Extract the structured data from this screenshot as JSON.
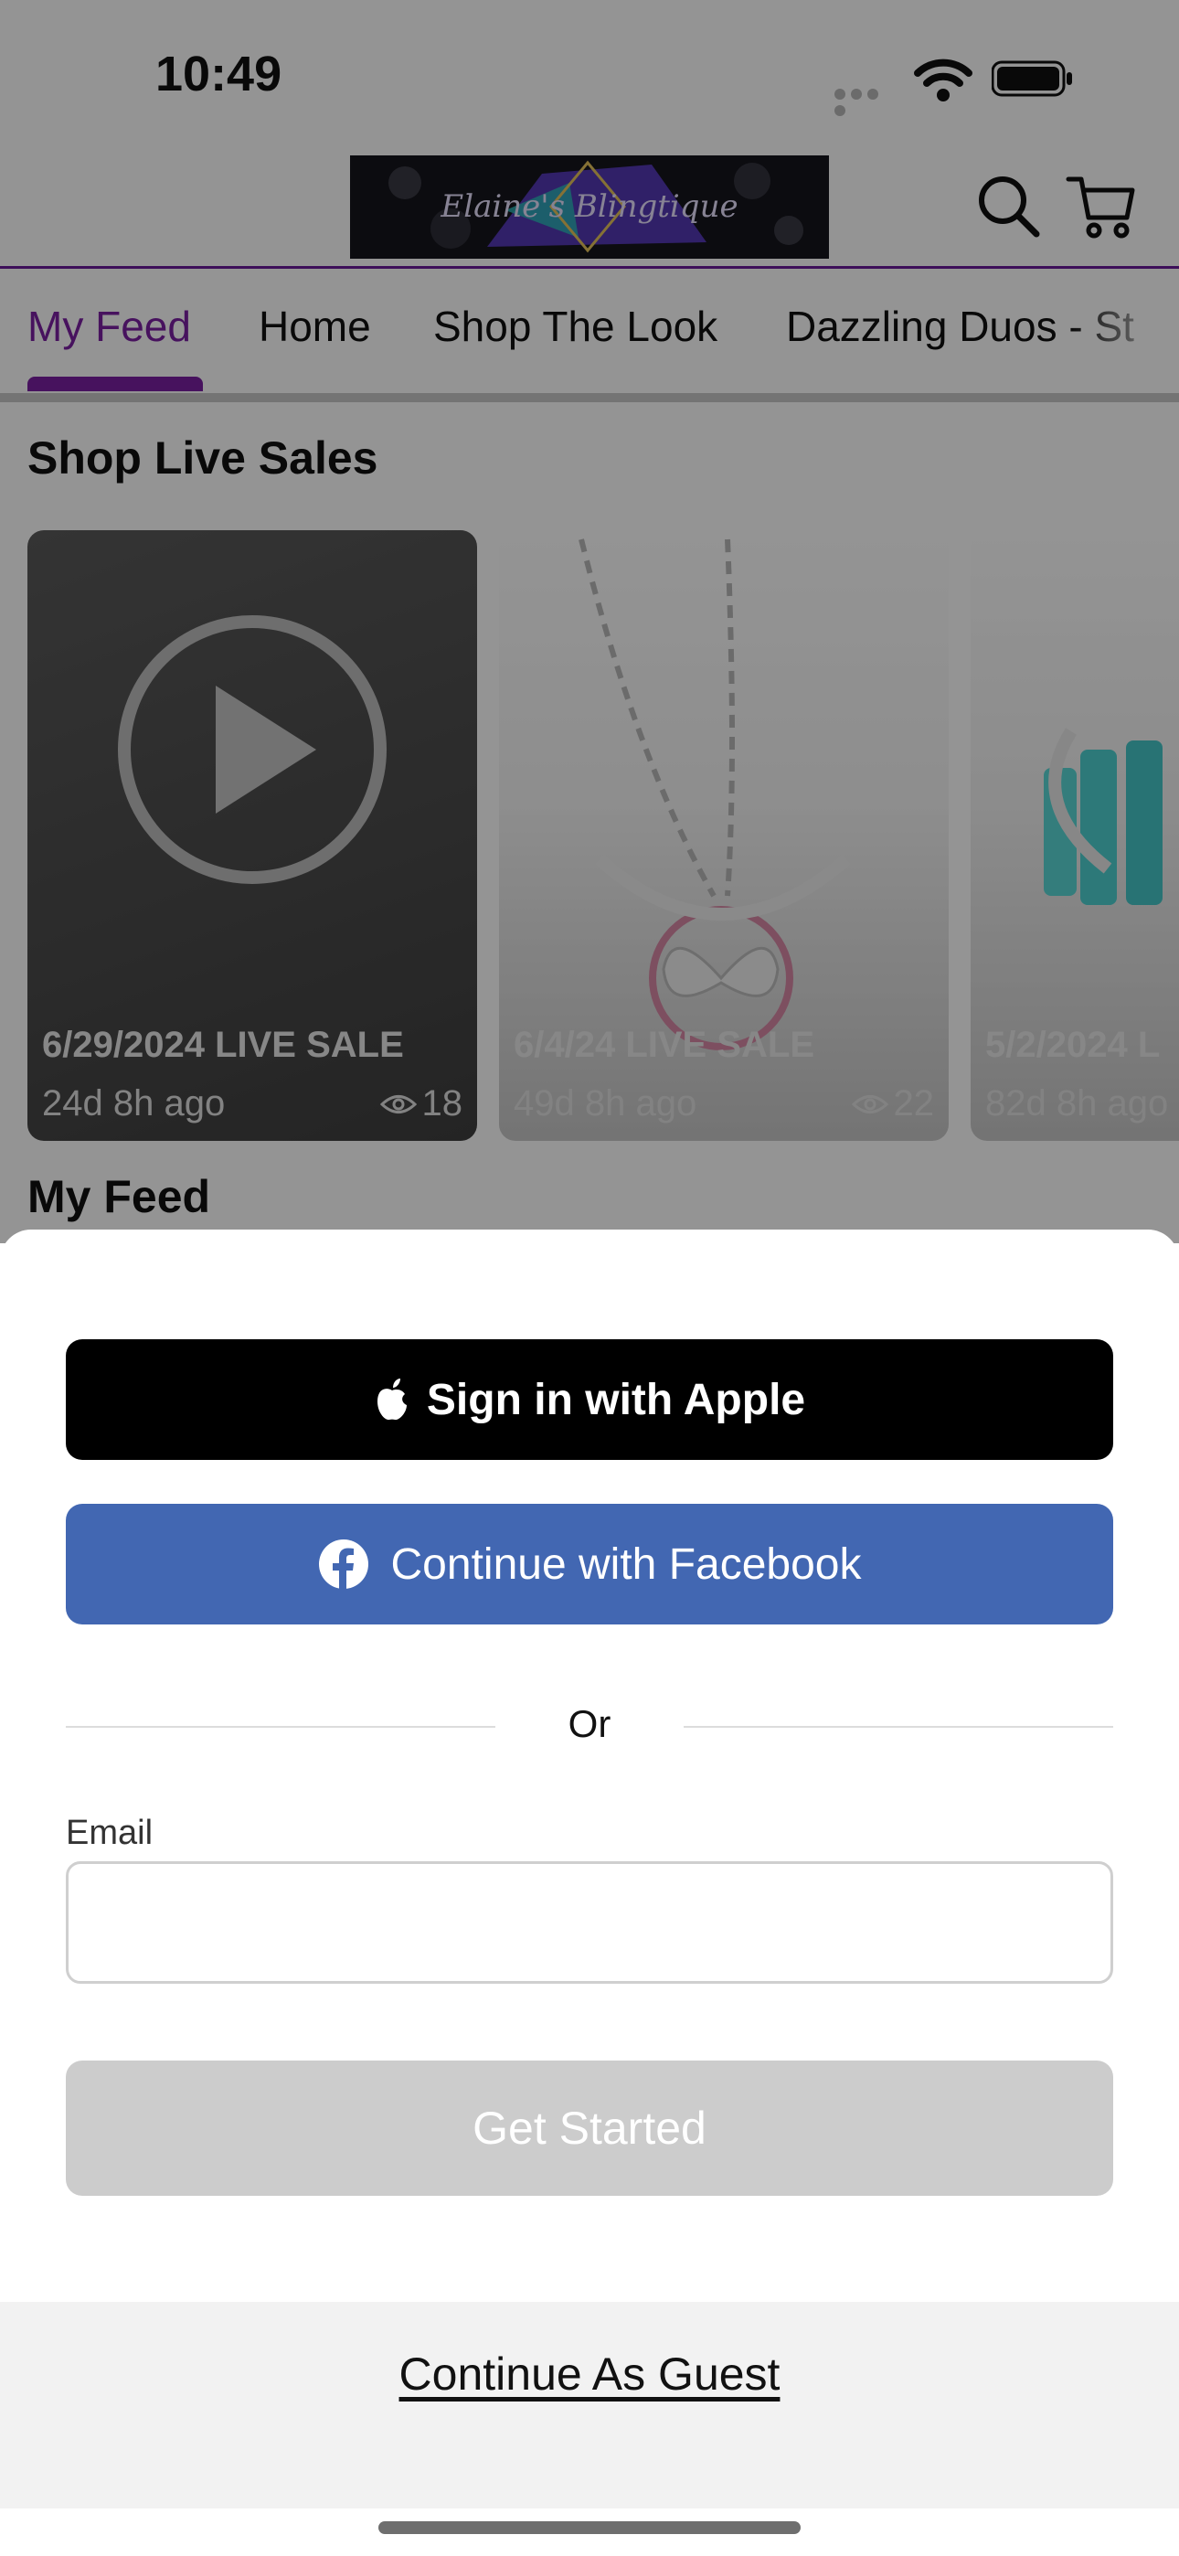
{
  "status_bar": {
    "time": "10:49"
  },
  "header": {
    "logo_text": "Elaine's Blingtique",
    "search_icon": "search-icon",
    "cart_icon": "cart-icon"
  },
  "tabs": [
    {
      "label": "My Feed",
      "active": true
    },
    {
      "label": "Home",
      "active": false
    },
    {
      "label": "Shop The Look",
      "active": false
    },
    {
      "label": "Dazzling Duos - St",
      "active": false
    }
  ],
  "live_sales": {
    "title": "Shop Live Sales",
    "cards": [
      {
        "title": "6/29/2024 LIVE SALE",
        "ago": "24d 8h ago",
        "views": "18"
      },
      {
        "title": "6/4/24 LIVE SALE",
        "ago": "49d 8h ago",
        "views": "22"
      },
      {
        "title": "5/2/2024 L",
        "ago": "82d 8h ago",
        "views": ""
      }
    ]
  },
  "feed": {
    "title": "My Feed"
  },
  "sign_in": {
    "apple_label": "Sign in with Apple",
    "facebook_label": "Continue with Facebook",
    "or_label": "Or",
    "email_label": "Email",
    "email_value": "",
    "get_started_label": "Get Started",
    "guest_label": "Continue As Guest"
  },
  "colors": {
    "accent": "#7a1fa2",
    "facebook": "#4267b2",
    "apple": "#000000",
    "disabled_button": "#cccccc"
  }
}
